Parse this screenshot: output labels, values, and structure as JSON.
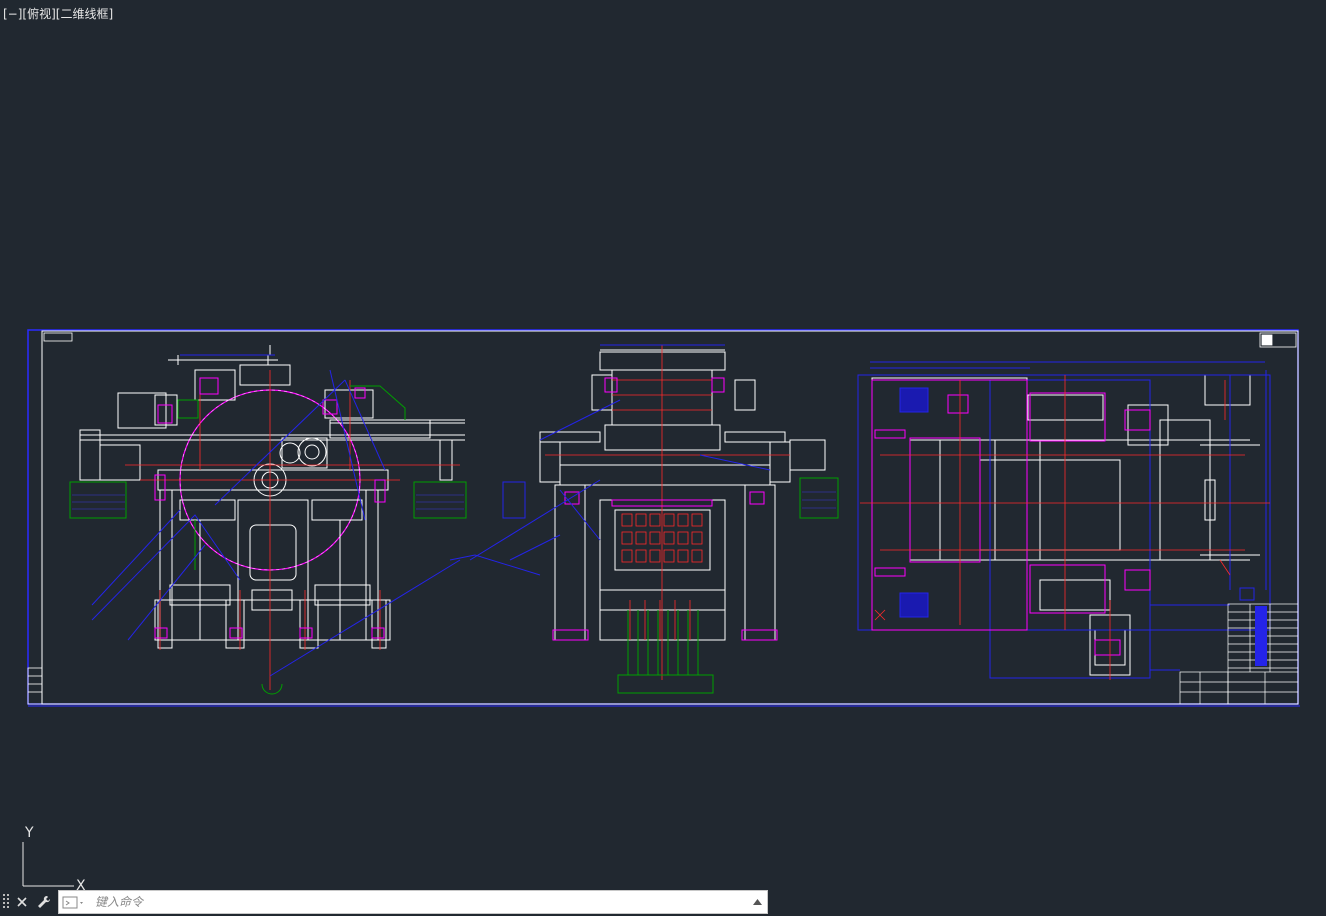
{
  "viewport": {
    "controls_label": "[−][俯视][二维线框]"
  },
  "ucs": {
    "x_label": "X",
    "y_label": "Y"
  },
  "command_line": {
    "placeholder": "键入命令",
    "close_icon": "close-icon",
    "customize_icon": "wrench-icon",
    "history_icon": "chevron-up-icon"
  },
  "colors": {
    "background": "#212830",
    "frame_blue": "#1a1aff",
    "line_white": "#ffffff",
    "line_red": "#ff2a2a",
    "line_magenta": "#ff00ff",
    "line_green": "#00a000",
    "line_blue": "#2020e0"
  }
}
